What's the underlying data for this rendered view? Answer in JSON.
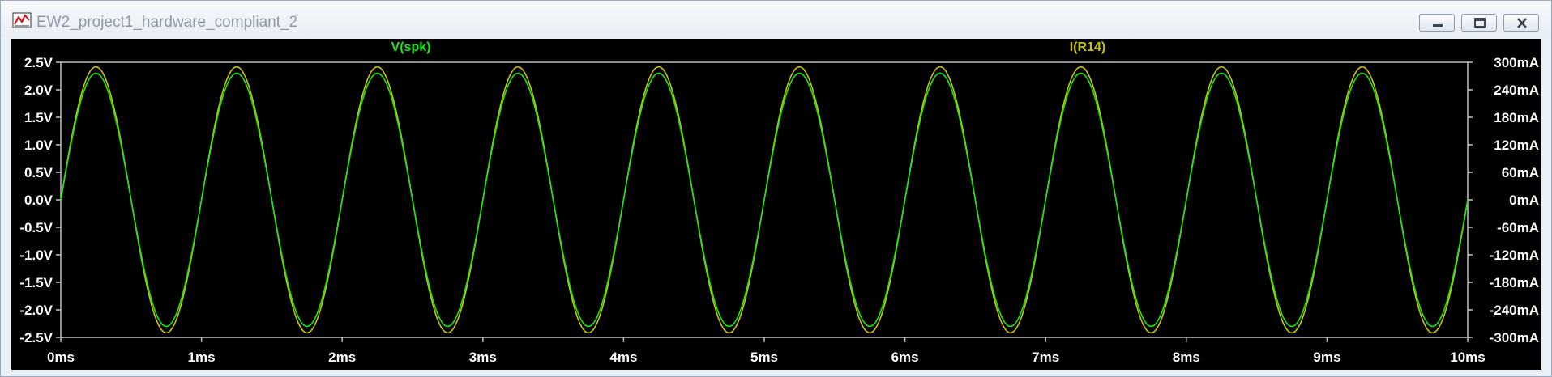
{
  "window": {
    "title": "EW2_project1_hardware_compliant_2",
    "app_icon": "waveform-icon",
    "controls": [
      "minimize-icon",
      "restore-icon",
      "close-icon"
    ]
  },
  "colors": {
    "background": "#000000",
    "axis": "#c0c0c0",
    "label": "#ffffff",
    "vspk": "#19e619",
    "ir14": "#c9c400"
  },
  "chart_data": {
    "type": "line",
    "xlabel": "",
    "x_ticks": [
      "0ms",
      "1ms",
      "2ms",
      "3ms",
      "4ms",
      "5ms",
      "6ms",
      "7ms",
      "8ms",
      "9ms",
      "10ms"
    ],
    "xlim": [
      0,
      10
    ],
    "y_left_ticks": [
      "2.5V",
      "2.0V",
      "1.5V",
      "1.0V",
      "0.5V",
      "0.0V",
      "-0.5V",
      "-1.0V",
      "-1.5V",
      "-2.0V",
      "-2.5V"
    ],
    "ylim_left": [
      -2.5,
      2.5
    ],
    "y_right_ticks": [
      "300mA",
      "240mA",
      "180mA",
      "120mA",
      "60mA",
      "0mA",
      "-60mA",
      "-120mA",
      "-180mA",
      "-240mA",
      "-300mA"
    ],
    "ylim_right": [
      -300,
      300
    ],
    "grid": false,
    "series": [
      {
        "name": "V(spk)",
        "axis": "left",
        "color_key": "vspk",
        "frequency_kHz": 1,
        "amplitude": 2.3,
        "unit": "V"
      },
      {
        "name": "I(R14)",
        "axis": "right",
        "color_key": "ir14",
        "frequency_kHz": 1,
        "amplitude": 290,
        "unit": "mA"
      }
    ]
  }
}
